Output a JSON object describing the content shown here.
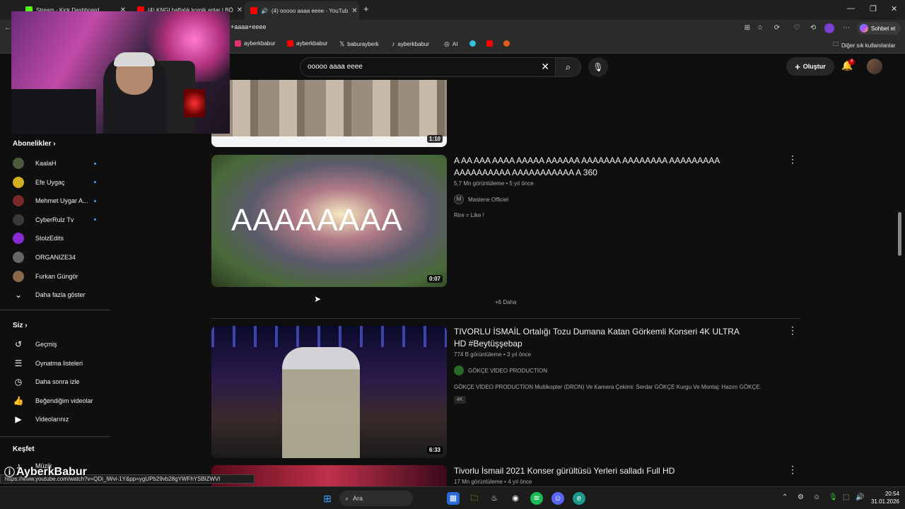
{
  "browser": {
    "tabs": [
      {
        "label": "Stream - Kick Dashboard",
        "color": "#53fc18"
      },
      {
        "label": "(4) KNGI haftalık komik anlar | BÖ",
        "color": "#ff0000"
      },
      {
        "label": "(4) ooooo aaaa eeee - YouTub",
        "color": "#ff0000"
      }
    ],
    "url": "+aaaa+eeee",
    "copilot_label": "Sohbet et",
    "bookmarks": [
      {
        "label": "ayberkbabur",
        "color": "#e1306c"
      },
      {
        "label": "ayberkbabur",
        "color": "#ff0000"
      },
      {
        "label": "baburayberk",
        "color": "#ffffff"
      },
      {
        "label": "ayberkbabur",
        "color": "#ffffff"
      },
      {
        "label": "AI",
        "color": "#aaaaaa"
      }
    ],
    "other_bookmarks": "Diğer sık kullanılanlar"
  },
  "youtube": {
    "search_query": "ooooo aaaa eeee",
    "create_label": "Oluştur",
    "notification_count": "4"
  },
  "sidebar": {
    "subscriptions_title": "Abonelikler",
    "subscriptions": [
      {
        "label": "KaalaH",
        "color": "#4a5a3a",
        "new": true
      },
      {
        "label": "Efe Uygaç",
        "color": "#d4b020",
        "new": true
      },
      {
        "label": "Mehmet Uygar A...",
        "color": "#7a2a2a",
        "new": true
      },
      {
        "label": "CyberRulz Tv",
        "color": "#3a3a3a",
        "new": true
      },
      {
        "label": "StolzEdits",
        "color": "#8a2ad4",
        "new": false
      },
      {
        "label": "ORGANIZE34",
        "color": "#666666",
        "new": false
      },
      {
        "label": "Furkan Güngör",
        "color": "#8a6a4a",
        "new": false
      }
    ],
    "show_more": "Daha fazla göster",
    "you_title": "Siz",
    "you_items": [
      {
        "label": "Geçmiş",
        "icon": "history-icon",
        "glyph": "↺"
      },
      {
        "label": "Oynatma listeleri",
        "icon": "playlist-icon",
        "glyph": "☰"
      },
      {
        "label": "Daha sonra izle",
        "icon": "clock-icon",
        "glyph": "◷"
      },
      {
        "label": "Beğendiğim videolar",
        "icon": "thumbs-up-icon",
        "glyph": "👍"
      },
      {
        "label": "Videolarınız",
        "icon": "video-icon",
        "glyph": "▶"
      }
    ],
    "explore_title": "Keşfet",
    "explore_first": "Müzik"
  },
  "videos": [
    {
      "duration": "1:10"
    },
    {
      "title": "A AA AAA AAAA AAAAA AAAAAA AAAAAAA AAAAAAAA AAAAAAAAA AAAAAAAAAA AAAAAAAAAAA A 360",
      "views": "5,7 Mn görüntüleme",
      "age": "5 yıl önce",
      "channel": "Mastene Officiel",
      "description": "Rire = Like !",
      "thumb_text": "AAAAAAAA",
      "duration": "0:07"
    },
    {
      "title": "TIVORLU İSMAİL Ortalığı Tozu Dumana Katan Görkemli Konseri 4K ULTRA HD #Beytüşşebap",
      "views": "774 B görüntüleme",
      "age": "3 yıl önce",
      "channel": "GÖKÇE VİDEO PRODUCTİON",
      "description": "GÖKÇE VİDEO PRODUCTİON Multikopter (DRON) Ve Kamera Çekimi: Serdar GÖKÇE Kurgu Ve Montaj: Hazım GÖKÇE.",
      "badge": "4K",
      "duration": "6:33"
    },
    {
      "title": "Tivorlu İsmail 2021 Konser gürültüsü Yerleri salladı Full HD",
      "views": "17 Mn görüntüleme",
      "age": "4 yıl önce"
    }
  ],
  "more_label": "+6 Daha",
  "status_url": "https://www.youtube.com/watch?v=QDi_lWvi-1Y&pp=ygUPb29vb28gYWFhYSBlZWVl",
  "watermark": "AyberkBabur",
  "taskbar": {
    "search_label": "Ara",
    "time": "20:54",
    "date": "31.01.2026"
  }
}
